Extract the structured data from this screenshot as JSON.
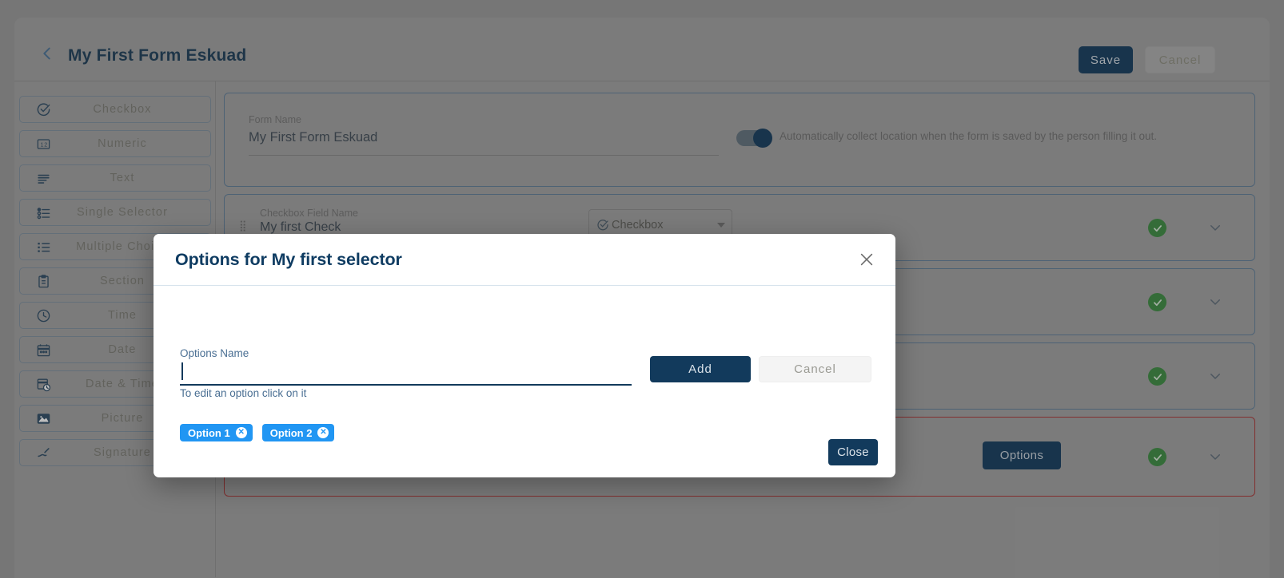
{
  "header": {
    "title": "My First Form Eskuad",
    "back_icon": "chevron-left-icon",
    "save_label": "Save",
    "cancel_label": "Cancel"
  },
  "sidebar": {
    "items": [
      {
        "label": "Checkbox",
        "icon": "checkbox-circle-icon"
      },
      {
        "label": "Numeric",
        "icon": "numeric-icon"
      },
      {
        "label": "Text",
        "icon": "text-lines-icon"
      },
      {
        "label": "Single Selector",
        "icon": "single-selector-icon"
      },
      {
        "label": "Multiple Choice",
        "icon": "multiple-choice-icon"
      },
      {
        "label": "Section",
        "icon": "clipboard-icon"
      },
      {
        "label": "Time",
        "icon": "clock-icon"
      },
      {
        "label": "Date",
        "icon": "calendar-icon"
      },
      {
        "label": "Date & Time",
        "icon": "calendar-clock-icon"
      },
      {
        "label": "Picture",
        "icon": "image-icon"
      },
      {
        "label": "Signature",
        "icon": "signature-icon"
      }
    ]
  },
  "form": {
    "name_label": "Form Name",
    "name_value": "My First Form Eskuad",
    "location_toggle_on": true,
    "location_toggle_text": "Automatically collect location when the form is saved by the person filling it out.",
    "rows": [
      {
        "field_label": "Checkbox Field Name",
        "field_value": "My first Check",
        "type": "Checkbox",
        "type_icon": "checkbox-circle-icon",
        "status": "valid",
        "has_options_button": false,
        "error": false
      },
      {
        "field_label": "",
        "field_value": "",
        "type": "",
        "type_icon": "",
        "status": "valid",
        "has_options_button": false,
        "error": false
      },
      {
        "field_label": "",
        "field_value": "",
        "type": "",
        "type_icon": "",
        "status": "valid",
        "has_options_button": false,
        "error": false
      },
      {
        "field_label": "",
        "field_value": "",
        "type": "",
        "type_icon": "",
        "status": "valid",
        "has_options_button": true,
        "options_label": "Options",
        "error": true
      }
    ]
  },
  "modal": {
    "title": "Options for My first selector",
    "close_icon": "close-icon",
    "input_label": "Options Name",
    "input_value": "",
    "input_placeholder": "",
    "hint": "To edit an option click on it",
    "add_label": "Add",
    "cancel_label": "Cancel",
    "close_label": "Close",
    "chips": [
      {
        "label": "Option 1",
        "remove_icon": "remove-chip-icon"
      },
      {
        "label": "Option 2",
        "remove_icon": "remove-chip-icon"
      }
    ]
  },
  "colors": {
    "navy": "#123a5c",
    "chip_blue": "#2196f3",
    "success_green": "#3a8a3f",
    "error_red": "#a33333"
  }
}
